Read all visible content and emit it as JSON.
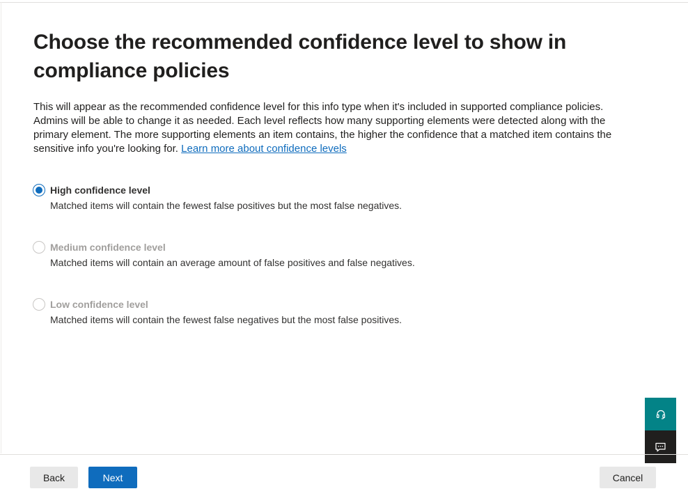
{
  "title": "Choose the recommended confidence level to show in compliance policies",
  "description": {
    "text": "This will appear as the recommended confidence level for this info type when it's included in supported compliance policies. Admins will be able to change it as needed. Each level reflects how many supporting elements were detected along with the primary element. The more supporting elements an item contains, the higher the confidence that a matched item contains the sensitive info you're looking for.",
    "link": "Learn more about confidence levels"
  },
  "options": [
    {
      "label": "High confidence level",
      "description": "Matched items will contain the fewest false positives but the most false negatives.",
      "selected": true
    },
    {
      "label": "Medium confidence level",
      "description": "Matched items will contain an average amount of false positives and false negatives.",
      "selected": false
    },
    {
      "label": "Low confidence level",
      "description": "Matched items will contain the fewest false negatives but the most false positives.",
      "selected": false
    }
  ],
  "footer": {
    "back_label": "Back",
    "next_label": "Next",
    "cancel_label": "Cancel"
  },
  "side_actions": {
    "help_icon": "headset-icon",
    "feedback_icon": "feedback-icon"
  },
  "colors": {
    "accent": "#0f6cbd",
    "help_bg": "#038387",
    "feedback_bg": "#201f1e"
  }
}
